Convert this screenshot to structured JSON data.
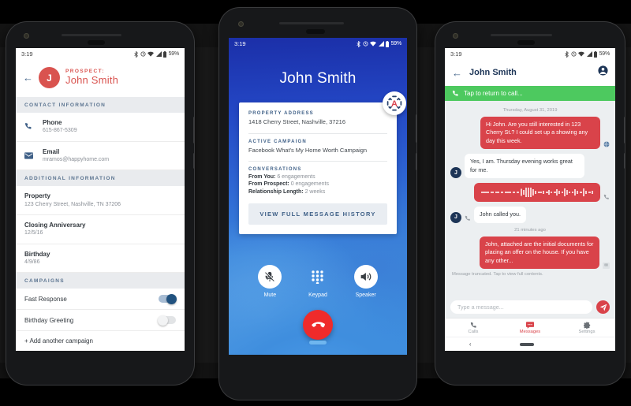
{
  "status_bar": {
    "time": "3:19",
    "battery": "59%",
    "icons": [
      "bluetooth-icon",
      "alarm-icon",
      "wifi-icon",
      "signal-icon",
      "battery-icon"
    ]
  },
  "phone1": {
    "header": {
      "back_icon": "back-arrow-icon",
      "avatar_initial": "J",
      "kicker": "PROSPECT:",
      "name": "John Smith"
    },
    "sections": [
      {
        "title": "CONTACT INFORMATION",
        "rows": [
          {
            "icon": "phone-icon",
            "title": "Phone",
            "sub": "615-867-5309"
          },
          {
            "icon": "email-icon",
            "title": "Email",
            "sub": "mramos@happyhome.com"
          }
        ]
      },
      {
        "title": "ADDITIONAL INFORMATION",
        "rows": [
          {
            "title": "Property",
            "sub": "123 Cherry Street, Nashville, TN 37206"
          },
          {
            "title": "Closing Anniversary",
            "sub": "12/5/16"
          },
          {
            "title": "Birthday",
            "sub": "4/9/86"
          }
        ]
      }
    ],
    "campaigns": {
      "title": "CAMPAIGNS",
      "items": [
        {
          "label": "Fast Response",
          "enabled": "on"
        },
        {
          "label": "Birthday Greeting",
          "enabled": "off"
        }
      ],
      "add_label": "+ Add another campaign"
    }
  },
  "phone2": {
    "caller_name": "John Smith",
    "badge_letter": "A",
    "card": {
      "property_label": "PROPERTY ADDRESS",
      "property_value": "1418 Cherry Street, Nashville, 37216",
      "campaign_label": "ACTIVE CAMPAIGN",
      "campaign_value": "Facebook What's My Home Worth Campaign",
      "conversations_label": "CONVERSATIONS",
      "stats": [
        {
          "label": "From You:",
          "value": "6 engagements"
        },
        {
          "label": "From Prospect:",
          "value": "0 engagements"
        },
        {
          "label": "Relationship Length:",
          "value": "2 weeks"
        }
      ],
      "history_button": "VIEW FULL MESSAGE HISTORY"
    },
    "actions": [
      {
        "icon": "mic-off-icon",
        "label": "Mute"
      },
      {
        "icon": "keypad-icon",
        "label": "Keypad"
      },
      {
        "icon": "speaker-icon",
        "label": "Speaker"
      }
    ],
    "end_call_icon": "end-call-icon"
  },
  "phone3": {
    "header": {
      "back_icon": "back-arrow-icon",
      "title": "John Smith",
      "profile_icon": "account-circle-icon"
    },
    "return_bar": {
      "icon": "phone-icon",
      "text": "Tap to return to call..."
    },
    "day_stamp": "Thursday, August 31, 2019",
    "messages": [
      {
        "dir": "out",
        "type": "text",
        "text": "Hi John. Are you still interested in 123 Cherry St.? I could set up a showing any day this week.",
        "badge": "globe-icon"
      },
      {
        "dir": "in",
        "type": "text",
        "avatar": "J",
        "text": "Yes, I am. Thursday evening works great for me."
      },
      {
        "dir": "out",
        "type": "audio",
        "badge": "phone-icon"
      },
      {
        "dir": "in",
        "type": "text",
        "avatar": "J",
        "badge": "phone-icon",
        "text": "John called you."
      }
    ],
    "time_stamp": "21 minutes ago",
    "last_message": {
      "text": "John, attached are the initial documents for placing an offer on the house. If you have any other...",
      "badge": "envelope-icon",
      "note": "Message truncated. Tap to view full contents."
    },
    "composer": {
      "placeholder": "Type a message...",
      "send_icon": "send-icon"
    },
    "tabs": [
      {
        "icon": "phone-icon",
        "label": "Calls",
        "active": "false"
      },
      {
        "icon": "message-icon",
        "label": "Messages",
        "active": "true"
      },
      {
        "icon": "gear-icon",
        "label": "Settings",
        "active": "false"
      }
    ],
    "navbar": {
      "back_icon": "nav-back-icon",
      "home_icon": "nav-home-pill"
    }
  },
  "colors": {
    "accent_red": "#d9434f",
    "call_blue": "#2f69d4",
    "green_bar": "#4dc95f",
    "slate": "#3f6087"
  }
}
